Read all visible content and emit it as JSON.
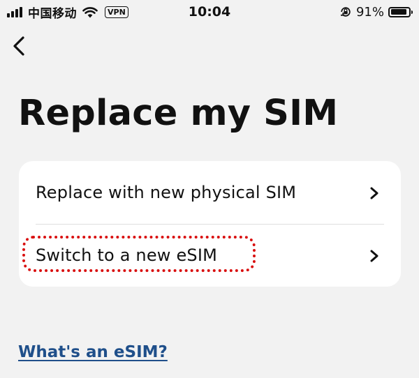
{
  "status_bar": {
    "carrier": "中国移动",
    "vpn_label": "VPN",
    "time": "10:04",
    "battery_percent": "91%",
    "battery_level": 0.91
  },
  "page": {
    "title": "Replace my SIM"
  },
  "options": [
    {
      "label": "Replace with new physical SIM",
      "icon": "chevron-right-icon"
    },
    {
      "label": "Switch to a new eSIM",
      "icon": "chevron-right-icon"
    }
  ],
  "link": {
    "label": "What's an eSIM?"
  },
  "colors": {
    "background": "#f2f2f2",
    "card": "#ffffff",
    "link": "#1f4f8a",
    "highlight": "#d90f0f"
  }
}
